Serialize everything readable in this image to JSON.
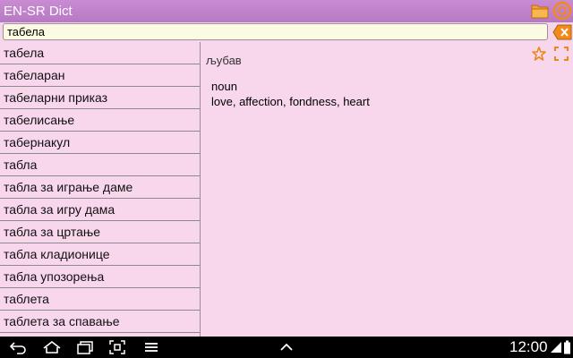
{
  "app": {
    "title": "EN-SR Dict"
  },
  "search": {
    "value": "табела"
  },
  "word_list": [
    "табела",
    "табеларан",
    "табеларни приказ",
    "табелисање",
    "табернакул",
    "табла",
    "табла за играње даме",
    "табла за игру дама",
    "табла за цртање",
    "табла кладионице",
    "табла упозорења",
    "таблета",
    "таблета за спавање"
  ],
  "detail": {
    "headword": "љубав",
    "part_of_speech": "noun",
    "definition": "love, affection, fondness, heart"
  },
  "status": {
    "time": "12:00"
  },
  "icons": {
    "folder": "folder-icon",
    "settings": "settings-icon",
    "clear": "clear-icon",
    "star": "star-icon",
    "expand": "expand-icon",
    "back": "back-icon",
    "home": "home-icon",
    "recent": "recent-apps-icon",
    "screenshot": "screenshot-icon",
    "menu": "menu-icon",
    "up": "chevron-up-icon",
    "wifi": "wifi-icon",
    "battery": "battery-icon"
  },
  "colors": {
    "title_bar": "#c084cc",
    "background": "#f8d6ec",
    "search_field": "#fafbe0",
    "accent": "#ef8a1f"
  }
}
